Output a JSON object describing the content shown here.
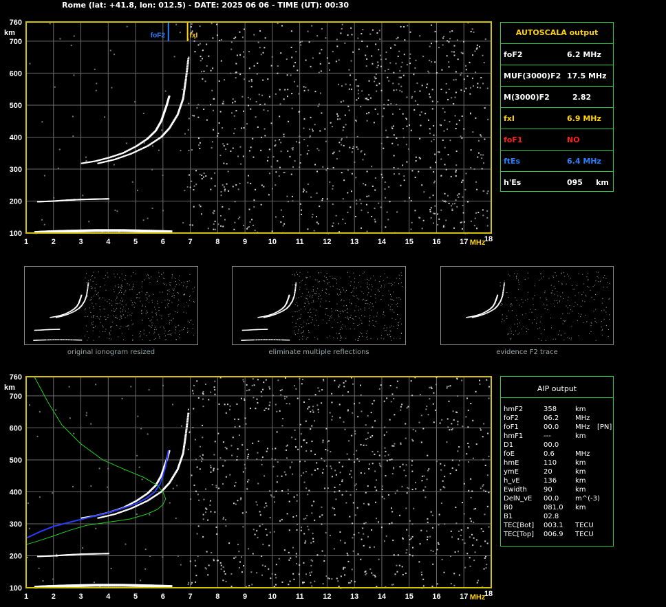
{
  "header": {
    "title": "Rome (lat: +41.8, lon: 012.5) - DATE: 2025 06 06 - TIME (UT): 00:30"
  },
  "chart_data": [
    {
      "type": "scatter",
      "name": "ionogram-autoscala",
      "xlabel": "MHz",
      "ylabel": "km",
      "xlim": [
        1,
        18
      ],
      "ylim": [
        100,
        760
      ],
      "x_ticks": [
        "1",
        "2",
        "3",
        "4",
        "5",
        "6",
        "7",
        "8",
        "9",
        "10",
        "11",
        "12",
        "13",
        "14",
        "15",
        "16",
        "17",
        "18"
      ],
      "y_ticks": [
        "100",
        "200",
        "300",
        "400",
        "500",
        "600",
        "700",
        "760"
      ],
      "grid": true,
      "markers": [
        {
          "label": "foF2",
          "value": 6.2,
          "color": "#2a7fff"
        },
        {
          "label": "fxI",
          "value": 6.9,
          "color": "#ffd400"
        }
      ],
      "traces": {
        "E_layer": {
          "x": [
            1.3,
            1.8,
            2.5,
            3.5,
            4.5,
            5.5,
            6.3
          ],
          "y": [
            104,
            106,
            108,
            110,
            110,
            108,
            106
          ]
        },
        "Es_echo": {
          "x": [
            1.4,
            2.0,
            2.5,
            3.0,
            3.5,
            4.0
          ],
          "y": [
            198,
            200,
            203,
            205,
            206,
            207
          ]
        },
        "F2_o": {
          "x": [
            3.0,
            3.5,
            4.0,
            4.5,
            5.0,
            5.4,
            5.7,
            5.9,
            6.0,
            6.1,
            6.2
          ],
          "y": [
            318,
            325,
            336,
            350,
            372,
            395,
            420,
            450,
            475,
            500,
            530
          ]
        },
        "F2_x": {
          "x": [
            3.6,
            4.2,
            4.8,
            5.4,
            5.9,
            6.2,
            6.5,
            6.7,
            6.8,
            6.9
          ],
          "y": [
            318,
            330,
            348,
            372,
            400,
            428,
            470,
            520,
            580,
            650
          ]
        }
      }
    },
    {
      "type": "scatter",
      "name": "ionogram-aip",
      "xlabel": "MHz",
      "ylabel": "km",
      "xlim": [
        1,
        18
      ],
      "ylim": [
        100,
        760
      ],
      "x_ticks": [
        "1",
        "2",
        "3",
        "4",
        "5",
        "6",
        "7",
        "8",
        "9",
        "10",
        "11",
        "12",
        "13",
        "14",
        "15",
        "16",
        "17",
        "18"
      ],
      "y_ticks": [
        "100",
        "200",
        "300",
        "400",
        "500",
        "600",
        "700",
        "760"
      ],
      "grid": true,
      "profile_green": {
        "x": [
          1.0,
          1.5,
          2.0,
          2.6,
          3.2,
          4.0,
          4.8,
          5.4,
          5.8,
          6.0,
          6.1,
          6.0,
          5.8,
          5.3,
          4.6,
          3.8,
          3.0,
          2.3,
          1.8,
          1.3
        ],
        "y": [
          235,
          248,
          262,
          280,
          295,
          305,
          315,
          330,
          345,
          360,
          378,
          400,
          420,
          445,
          470,
          500,
          550,
          610,
          680,
          760
        ]
      },
      "profile_blue": {
        "x": [
          1.0,
          1.5,
          2.0,
          2.6,
          3.2,
          3.8,
          4.4,
          5.0,
          5.4,
          5.7,
          5.9,
          6.0,
          6.1,
          6.2
        ],
        "y": [
          255,
          275,
          292,
          305,
          318,
          330,
          345,
          362,
          380,
          400,
          425,
          450,
          480,
          530
        ]
      }
    }
  ],
  "autoscala": {
    "title": "AUTOSCALA output",
    "rows": [
      {
        "label": "foF2",
        "value": "6.2 MHz",
        "color": "#ffffff"
      },
      {
        "label": "MUF(3000)F2",
        "value": "17.5 MHz",
        "color": "#ffffff"
      },
      {
        "label": "M(3000)F2",
        "value": "2.82",
        "color": "#ffffff"
      },
      {
        "label": "fxI",
        "value": "6.9 MHz",
        "color": "#ffd400"
      },
      {
        "label": "foF1",
        "value": "NO",
        "color": "#ff2020"
      },
      {
        "label": "ftEs",
        "value": "6.4 MHz",
        "color": "#2a7fff"
      },
      {
        "label": "h'Es",
        "value": "095     km",
        "color": "#ffffff"
      }
    ]
  },
  "thumbnails": [
    {
      "caption": "original ionogram resized"
    },
    {
      "caption": "eliminate multiple reflections"
    },
    {
      "caption": "evidence F2 trace"
    }
  ],
  "aip": {
    "title": "AIP output",
    "rows": [
      {
        "name": "hmF2",
        "value": "358",
        "unit": "km",
        "extra": ""
      },
      {
        "name": "foF2",
        "value": "06.2",
        "unit": "MHz",
        "extra": ""
      },
      {
        "name": "foF1",
        "value": "00.0",
        "unit": "MHz",
        "extra": "[PN]"
      },
      {
        "name": "hmF1",
        "value": "---",
        "unit": "km",
        "extra": ""
      },
      {
        "name": "D1",
        "value": "00.0",
        "unit": "",
        "extra": ""
      },
      {
        "name": "foE",
        "value": "0.6",
        "unit": "MHz",
        "extra": ""
      },
      {
        "name": "hmE",
        "value": "110",
        "unit": "km",
        "extra": ""
      },
      {
        "name": "ymE",
        "value": "20",
        "unit": "km",
        "extra": ""
      },
      {
        "name": "h_vE",
        "value": "136",
        "unit": "km",
        "extra": ""
      },
      {
        "name": "Ewidth",
        "value": "90",
        "unit": "km",
        "extra": ""
      },
      {
        "name": "DelN_vE",
        "value": "00.0",
        "unit": "m^(-3)",
        "extra": ""
      },
      {
        "name": "B0",
        "value": "081.0",
        "unit": "km",
        "extra": ""
      },
      {
        "name": "B1",
        "value": "02.8",
        "unit": "",
        "extra": ""
      },
      {
        "name": "TEC[Bot]",
        "value": "003.1",
        "unit": "TECU",
        "extra": ""
      },
      {
        "name": "TEC[Top]",
        "value": "006.9",
        "unit": "TECU",
        "extra": ""
      }
    ]
  },
  "colors": {
    "frame": "#d4c400",
    "grid": "#6b6b6b",
    "panel_border": "#2ecc40",
    "tick_x": "#ffffff",
    "unit": "#ffd400"
  }
}
